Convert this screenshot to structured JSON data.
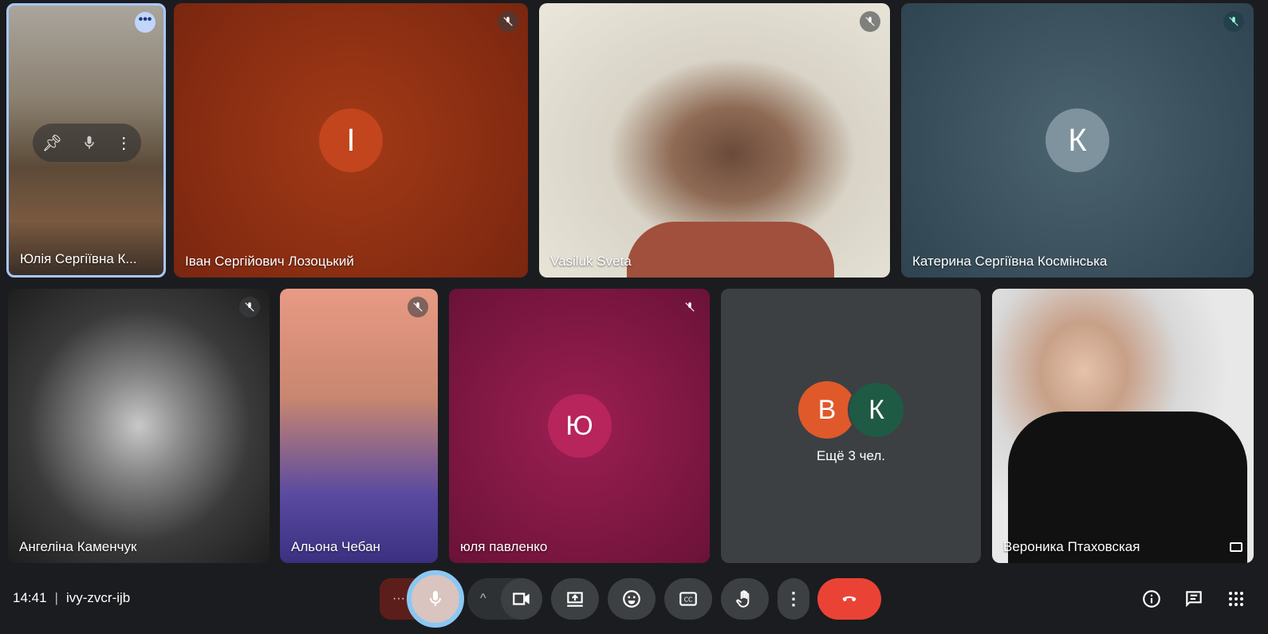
{
  "tiles": [
    {
      "name": "Юлія Сергіївна К...",
      "type": "video"
    },
    {
      "name": "Іван Сергійович Лозоцький",
      "initial": "І",
      "muted": true
    },
    {
      "name": "Vasiluk Sveta",
      "muted": true
    },
    {
      "name": "Катерина Сергіївна Космінська",
      "initial": "К",
      "muted": true
    },
    {
      "name": "Ангеліна Каменчук",
      "muted": true
    },
    {
      "name": "Альона Чебан",
      "muted": true
    },
    {
      "name": "юля павленко",
      "initial": "Ю",
      "muted": true
    },
    {
      "more_label": "Ещё 3 чел.",
      "initials": [
        "В",
        "К"
      ]
    },
    {
      "name": "Вероника Птаховская"
    }
  ],
  "footer": {
    "time": "14:41",
    "separator": "|",
    "meeting_code": "ivy-zvcr-ijb"
  },
  "colors": {
    "accent": "#a8c7fa",
    "end_call": "#ea4335",
    "background": "#1b1c1f"
  }
}
